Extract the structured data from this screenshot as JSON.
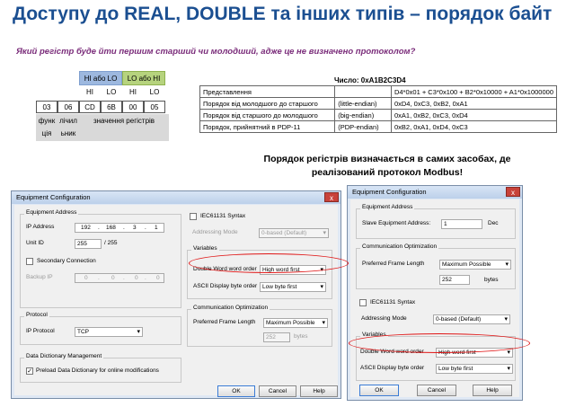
{
  "slide": {
    "title": "Доступу до REAL, DOUBLE та інших типів – порядок байт",
    "question": "Який регістр буде йти першим старший чи молодший, адже це не визначено протоколом?",
    "note_line1": "Порядок регістрів визначається в самих засобах, де",
    "note_line2": "реалізований протокол Modbus!"
  },
  "frame": {
    "hi_or_lo": "HI або LO",
    "lo_or_hi": "LO або HI",
    "sub": [
      "HI",
      "LO",
      "HI",
      "LO"
    ],
    "bytes": [
      "03",
      "06",
      "CD",
      "6B",
      "00",
      "05"
    ],
    "label_func_1": "функ",
    "label_func_2": "ція",
    "label_cnt_1": "лічил",
    "label_cnt_2": "ьник",
    "label_values": "значення регістрів"
  },
  "byte_table": {
    "number_label": "Число: 0xA1B2C3D4",
    "rows": [
      [
        "Представлення",
        "",
        "D4*0x01 + C3*0x100 + B2*0x10000 + A1*0x1000000"
      ],
      [
        "Порядок від молодшого до старшого",
        "(little-endian)",
        "0xD4, 0xC3, 0xB2, 0xA1"
      ],
      [
        "Порядок від старшого до молодшого",
        "(big-endian)",
        "0xA1, 0xB2, 0xC3, 0xD4"
      ],
      [
        "Порядок, прийнятний в PDP-11",
        "(PDP-endian)",
        "0xB2, 0xA1, 0xD4, 0xC3"
      ]
    ]
  },
  "dialog1": {
    "title": "Equipment Configuration",
    "close": "x",
    "equipment_address_group": "Equipment Address",
    "ip_address_label": "IP Address",
    "ip": [
      "192",
      "168",
      "3",
      "1"
    ],
    "unit_id_label": "Unit ID",
    "unit_id_value": "255",
    "unit_id_max": "/ 255",
    "secondary_connection": "Secondary Connection",
    "backup_ip_label": "Backup IP",
    "backup_ip": [
      "0",
      "0",
      "0",
      "0"
    ],
    "iec_syntax": "IEC61131 Syntax",
    "addressing_mode_label": "Addressing Mode",
    "addressing_mode_value": "0-based (Default)",
    "variables_group": "Variables",
    "dword_order_label": "Double Word word order",
    "dword_order_value": "High word first",
    "ascii_order_label": "ASCII Display byte order",
    "ascii_order_value": "Low byte first",
    "protocol_group": "Protocol",
    "ip_protocol_label": "IP Protocol",
    "ip_protocol_value": "TCP",
    "comm_opt_group": "Communication Optimization",
    "frame_length_label": "Preferred Frame Length",
    "frame_length_value": "Maximum Possible",
    "frame_bytes_value": "252",
    "bytes_unit": "bytes",
    "dd_group": "Data Dictionary Management",
    "preload_dd": "Preload Data Dictionary for online modifications",
    "ok": "OK",
    "cancel": "Cancel",
    "help": "Help"
  },
  "dialog2": {
    "title": "Equipment Configuration",
    "close": "x",
    "equipment_address_group": "Equipment Address",
    "slave_address_label": "Slave Equipment Address:",
    "slave_address_value": "1",
    "slave_address_unit": "Dec",
    "comm_opt_group": "Communication Optimization",
    "frame_length_label": "Preferred Frame Length",
    "frame_length_value": "Maximum Possible",
    "frame_bytes_value": "252",
    "bytes_unit": "bytes",
    "iec_syntax": "IEC61131 Syntax",
    "addressing_mode_label": "Addressing Mode",
    "addressing_mode_value": "0-based (Default)",
    "variables_group": "Variables",
    "dword_order_label": "Double Word word order",
    "dword_order_value": "High word first",
    "ascii_order_label": "ASCII Display byte order",
    "ascii_order_value": "Low byte first",
    "ok": "OK",
    "cancel": "Cancel",
    "help": "Help"
  },
  "colors": {
    "title": "#1b4f91",
    "question": "#7a2c7a",
    "highlight_ellipse": "#e01515",
    "hi_header": "#9db8df",
    "lo_header": "#b6d37e"
  }
}
